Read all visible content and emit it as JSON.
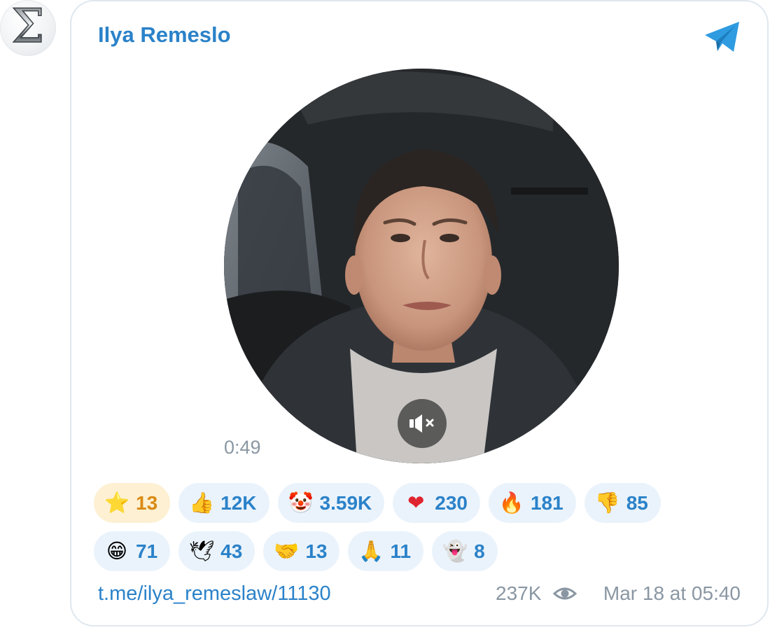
{
  "post": {
    "channel_name": "Ilya Remeslo",
    "video_duration": "0:49",
    "link": "t.me/ilya_remeslaw/11130",
    "views": "237K",
    "date": "Mar 18 at 05:40"
  },
  "avatar": {
    "glyph": "Σ"
  },
  "reactions": [
    {
      "emoji": "⭐",
      "count": "13"
    },
    {
      "emoji": "👍",
      "count": "12K"
    },
    {
      "emoji": "🤡",
      "count": "3.59K"
    },
    {
      "emoji": "❤",
      "count": "230"
    },
    {
      "emoji": "🔥",
      "count": "181"
    },
    {
      "emoji": "👎",
      "count": "85"
    },
    {
      "emoji": "😁",
      "count": "71"
    },
    {
      "emoji": "🕊",
      "count": "43"
    },
    {
      "emoji": "🤝",
      "count": "13"
    },
    {
      "emoji": "🙏",
      "count": "11"
    },
    {
      "emoji": "👻",
      "count": "8"
    }
  ],
  "icons": {
    "telegram": "telegram-plane-icon",
    "mute": "volume-muted-icon",
    "views": "eye-icon"
  },
  "colors": {
    "accent": "#2b82c9",
    "muted_text": "#8a97a3",
    "chip_bg": "#eaf3fb",
    "star_chip_bg": "#fdf0d3",
    "star_count": "#d98b14",
    "card_border": "#dfe7ee"
  }
}
